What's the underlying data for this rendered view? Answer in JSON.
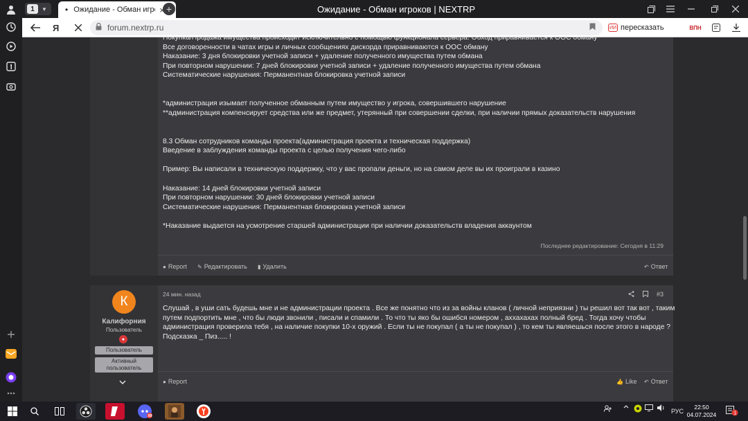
{
  "browser": {
    "tab_count": "1",
    "tab_title": "Ожидание - Обман игроков",
    "window_title": "Ожидание - Обман игроков | NEXTRP",
    "url": "forum.nextrp.ru",
    "retell_label": "пересказать",
    "retell_badge": "ИИ",
    "side_label": "ВПН"
  },
  "post1": {
    "lines": [
      "Покупка/Продажа имущества происходит исключительно с помощью функционала сервера. Обход приравнивается к ООС обману",
      "Все договоренности в чатах игры и личных сообщениях дискорда приравниваются к ООС обману",
      "Наказание: 3 дня блокировки учетной записи + удаление полученного имущества путем обмана",
      "При повторном нарушении: 7 дней блокировки учетной записи + удаление полученного имущества путем обмана",
      "Систематические нарушения: Перманентная блокировка учетной записи",
      "",
      "",
      "*администрация изымает полученное обманным путем имущество у игрока, совершившего нарушение",
      "**администрация компенсирует средства или же предмет, утерянный при совершении сделки, при наличии прямых доказательств нарушения",
      "",
      "",
      "8.3 Обман сотрудников команды проекта(администрация проекта и техническая поддержка)",
      "Введение в заблуждения команды проекта с целью получения чего-либо",
      "",
      "Пример: Вы написали в техническую поддержку, что у вас пропали деньги, но на самом деле вы их проиграли в казино",
      "",
      "Наказание: 14 дней блокировки учетной записи",
      "При повторном нарушении: 30 дней блокировки учетной записи",
      "Систематические нарушения: Перманентная блокировка учетной записи",
      "",
      "*Наказание выдается на усмотрение старшей администрации при наличии доказательств владения аккаунтом"
    ],
    "edited": "Последнее редактирование: Сегодня в 11:29",
    "actions": {
      "report": "Report",
      "edit": "Редактировать",
      "delete": "Удалить",
      "reply": "Ответ"
    }
  },
  "post2": {
    "date": "24 мин. назад",
    "number": "#3",
    "user": {
      "initial": "К",
      "name": "Калифорния",
      "title": "Пользователь",
      "banners": [
        "Пользователь",
        "Активный пользователь"
      ]
    },
    "lines": [
      "Слушай , в уши сать будешь мне и не администрации проекта . Все же понятно что из за войны кланов ( личной неприязни ) ты решил вот так вот , таким",
      "путем подпортить мне , что бы люди звонили , писали и спамили . То что ты яко бы ошибся номером , аххахахах полный бред . Тогда хочу чтобы",
      "администрация проверила тебя , на наличие покупки 10-х оружий . Если ты не покупал ( а ты не покупал ) , то кем ты являешься после этого в народе ?",
      "Подсказка _ Пиз..... !"
    ],
    "actions": {
      "report": "Report",
      "like": "Like",
      "reply": "Ответ"
    }
  },
  "taskbar": {
    "lang": "РУС",
    "time": "22:50",
    "date": "04.07.2024",
    "notif_count": "1",
    "discord_badge": "99"
  },
  "colors": {
    "page_bg": "#2b2b2e",
    "post_bg": "#3b3b3f",
    "avatar": "#f0851d"
  }
}
